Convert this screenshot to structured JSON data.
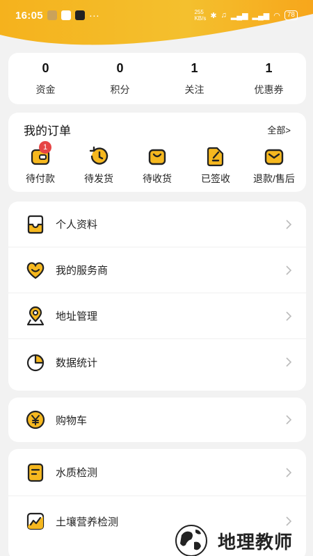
{
  "status_bar": {
    "time": "16:05",
    "net_speed_value": "255",
    "net_speed_unit": "KB/s",
    "battery": "78"
  },
  "stats": [
    {
      "value": "0",
      "label": "资金"
    },
    {
      "value": "0",
      "label": "积分"
    },
    {
      "value": "1",
      "label": "关注"
    },
    {
      "value": "1",
      "label": "优惠券"
    }
  ],
  "orders": {
    "title": "我的订单",
    "all_label": "全部>",
    "items": [
      {
        "label": "待付款",
        "icon": "wallet-icon",
        "badge": "1"
      },
      {
        "label": "待发货",
        "icon": "clock-back-icon"
      },
      {
        "label": "待收货",
        "icon": "bag-icon"
      },
      {
        "label": "已签收",
        "icon": "sign-icon"
      },
      {
        "label": "退款/售后",
        "icon": "mail-icon"
      }
    ]
  },
  "menu": [
    {
      "label": "个人资料",
      "icon": "inbox-profile-icon"
    },
    {
      "label": "我的服务商",
      "icon": "heart-smile-icon"
    },
    {
      "label": "地址管理",
      "icon": "location-pin-icon"
    },
    {
      "label": "数据统计",
      "icon": "pie-chart-icon"
    }
  ],
  "menu2": [
    {
      "label": "购物车",
      "icon": "yen-coin-icon"
    }
  ],
  "menu3": [
    {
      "label": "水质检测",
      "icon": "document-icon"
    },
    {
      "label": "土壤营养检测",
      "icon": "trend-chart-icon"
    }
  ],
  "watermark": {
    "text": "地理教师"
  },
  "colors": {
    "accent": "#f6b81f",
    "accent_dark": "#e59a12",
    "badge": "#e64545"
  }
}
